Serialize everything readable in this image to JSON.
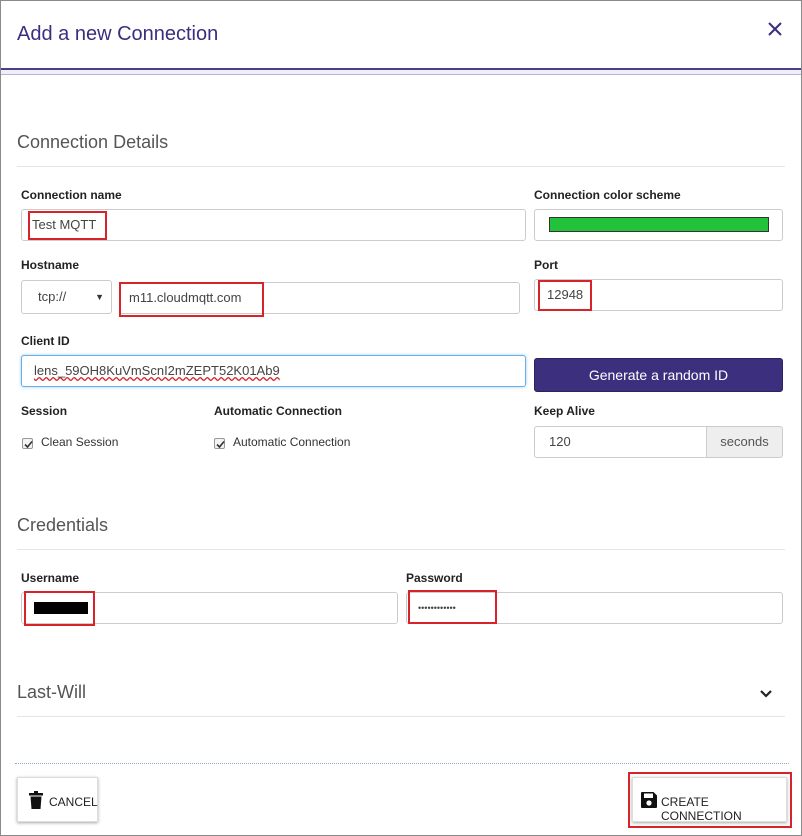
{
  "dialog": {
    "title": "Add a new Connection",
    "close_icon": "close-icon"
  },
  "connection_details": {
    "heading": "Connection Details",
    "name_label": "Connection name",
    "name_value": "Test MQTT",
    "color_label": "Connection color scheme",
    "color_value": "#22c33a",
    "hostname_label": "Hostname",
    "protocol_value": "tcp://",
    "hostname_value": "m11.cloudmqtt.com",
    "port_label": "Port",
    "port_value": "12948",
    "client_id_label": "Client ID",
    "client_id_value": "lens_59OH8KuVmScnI2mZEPT52K01Ab9",
    "generate_button": "Generate a random ID",
    "session_label": "Session",
    "clean_session_label": "Clean Session",
    "clean_session_checked": true,
    "auto_connection_label": "Automatic Connection",
    "auto_connection_checkbox_label": "Automatic Connection",
    "auto_connection_checked": true,
    "keep_alive_label": "Keep Alive",
    "keep_alive_value": "120",
    "keep_alive_unit": "seconds"
  },
  "credentials": {
    "heading": "Credentials",
    "username_label": "Username",
    "password_label": "Password",
    "password_value": "••••••••••••"
  },
  "last_will": {
    "heading": "Last-Will",
    "expand_icon": "chevron-down-icon"
  },
  "footer": {
    "cancel_label": "CANCEL",
    "cancel_icon": "trash-icon",
    "create_label": "CREATE CONNECTION",
    "create_icon": "save-icon"
  },
  "colors": {
    "accent": "#3c2f7e",
    "highlight": "#d9232a",
    "swatch": "#22c33a"
  }
}
